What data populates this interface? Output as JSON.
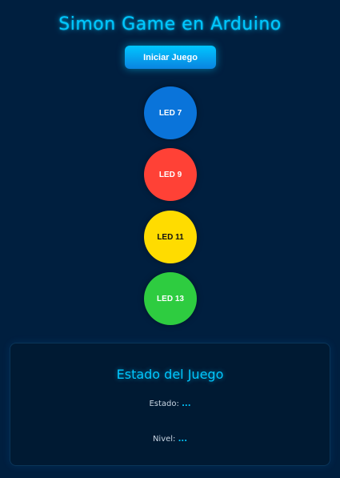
{
  "header": {
    "title": "Simon Game en Arduino",
    "start_button_label": "Iniciar Juego"
  },
  "leds": [
    {
      "label": "LED 7",
      "color": "#0a74da"
    },
    {
      "label": "LED 9",
      "color": "#ff4136"
    },
    {
      "label": "LED 11",
      "color": "#ffdc00"
    },
    {
      "label": "LED 13",
      "color": "#2ecc40"
    }
  ],
  "status_panel": {
    "title": "Estado del Juego",
    "estado_label": "Estado:",
    "estado_value": "...",
    "nivel_label": "Nivel:",
    "nivel_value": "..."
  },
  "colors": {
    "background": "#001f3f",
    "accent": "#00c8ff",
    "panel_background": "#001a33"
  }
}
